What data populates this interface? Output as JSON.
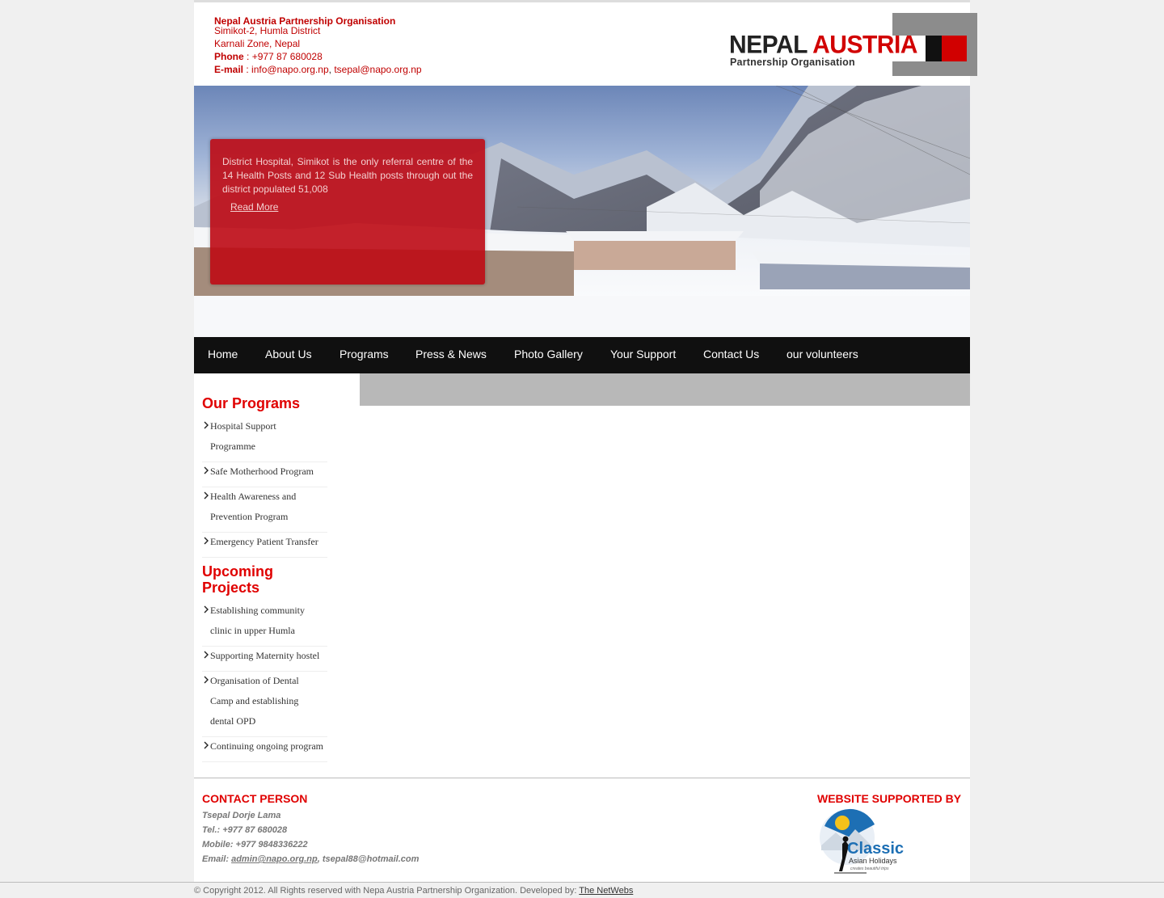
{
  "header": {
    "org_name": "Nepal Austria Partnership Organisation",
    "address1": "Simikot-2, Humla District",
    "address2": "Karnali Zone, Nepal",
    "phone_label": "Phone",
    "phone_sep": " : ",
    "phone_value": "+977 87 680028",
    "email_label": "E-mail",
    "email_sep": " : ",
    "email1": "info@napo.org.np",
    "email_comma": ",",
    "email2": "tsepal@napo.org.np"
  },
  "logo": {
    "word1": "NEPAL",
    "word2": "AUSTRIA",
    "subtitle": "Partnership Organisation"
  },
  "banner": {
    "caption": "District Hospital, Simikot is the only referral centre of the 14 Health Posts and 12 Sub Health posts through out the district populated 51,008",
    "read_more": "Read More"
  },
  "nav": {
    "items": [
      "Home",
      "About Us",
      "Programs",
      "Press & News",
      "Photo Gallery",
      "Your Support",
      "Contact Us",
      "our volunteers"
    ]
  },
  "sidebar": {
    "programs_title": "Our Programs",
    "programs": [
      "Hospital Support Programme",
      "Safe Motherhood Program",
      "Health Awareness and Prevention Program",
      "Emergency Patient Transfer"
    ],
    "projects_title": "Upcoming Projects",
    "projects": [
      "Establishing community clinic in upper Humla",
      "Supporting Maternity hostel",
      "Organisation of Dental Camp and establishing dental OPD",
      "Continuing ongoing program"
    ]
  },
  "footer": {
    "contact_title": "CONTACT PERSON",
    "name": "Tsepal Dorje Lama",
    "tel": "Tel.: +977 87 680028",
    "mobile": "Mobile: +977 9848336222",
    "email_label": "Email: ",
    "email_link": "admin@napo.org.np",
    "email_rest": ", tsepal88@hotmail.com",
    "supported_title": "WEBSITE SUPPORTED BY",
    "sponsor_word1": "Classic",
    "sponsor_word2": "Asian Holidays",
    "sponsor_tag": "creates beautiful trips"
  },
  "copyright": {
    "text": "© Copyright 2012. All Rights reserved with Nepa Austria Partnership Organization. Developed by: ",
    "dev_link": "The NetWebs"
  },
  "colors": {
    "accent_red": "#e00000",
    "nav_bg": "#101010",
    "caption_bg": "#be0a14"
  }
}
